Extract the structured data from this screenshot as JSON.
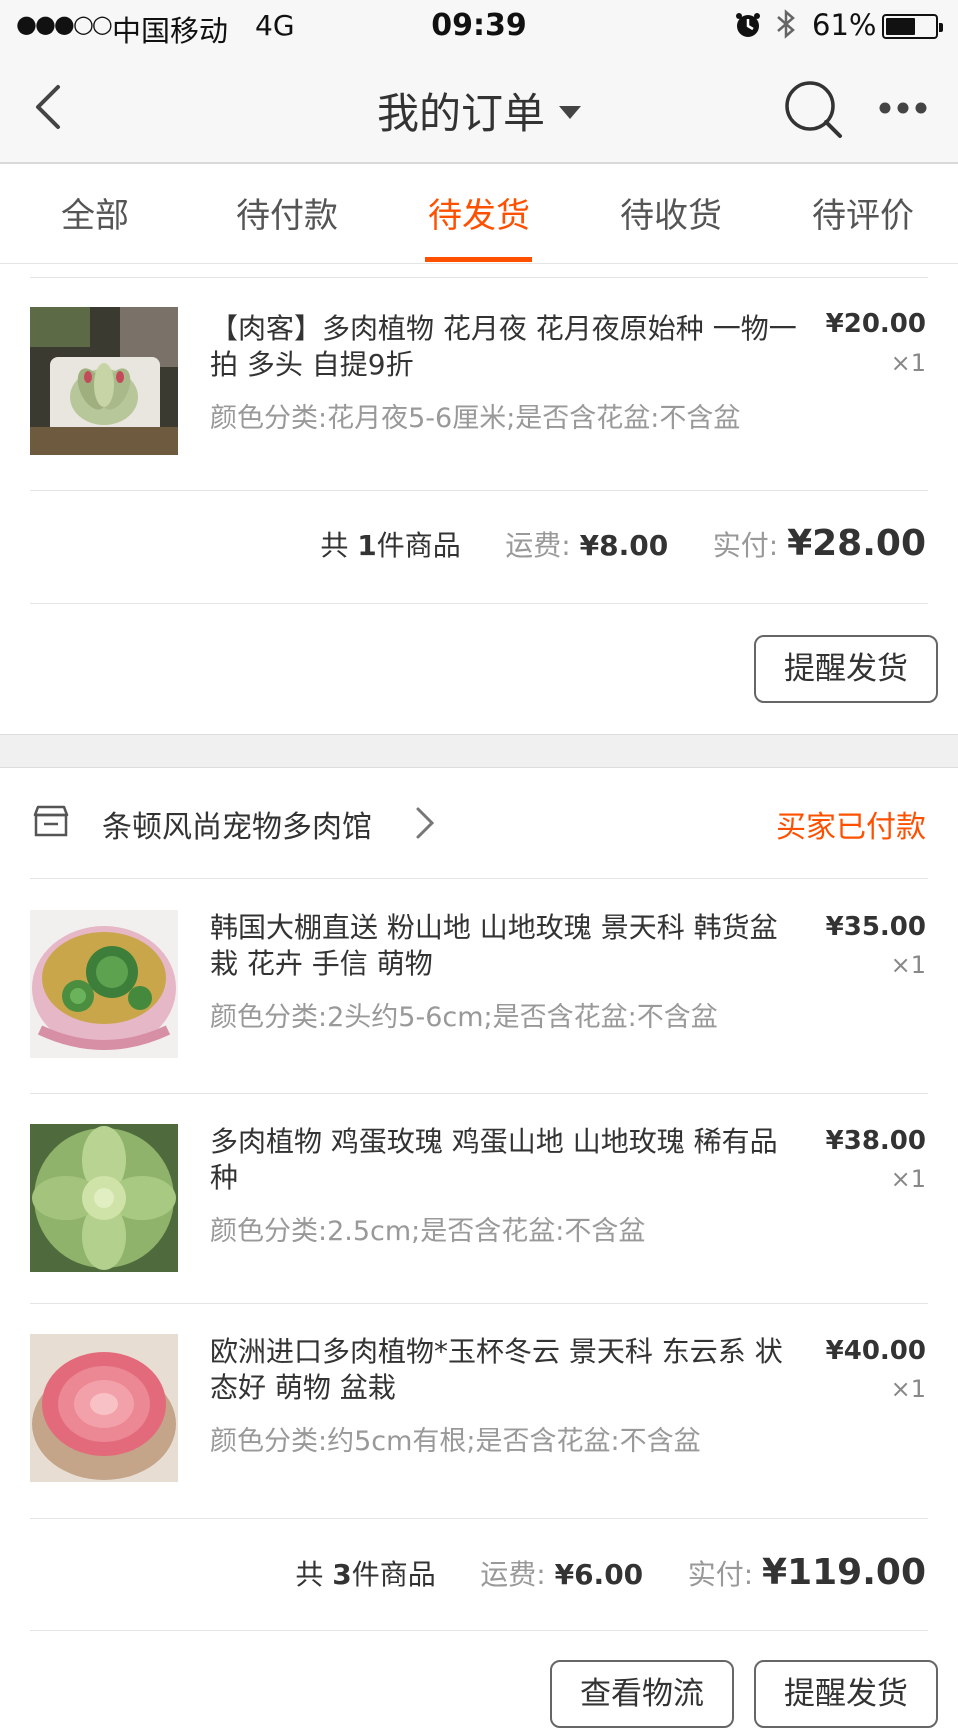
{
  "status_bar": {
    "signal": "●●●○○",
    "carrier": "中国移动",
    "network": "4G",
    "time": "09:39",
    "battery_pct": "61%",
    "battery_level": 0.61
  },
  "nav": {
    "title": "我的订单"
  },
  "tabs": [
    {
      "label": "全部"
    },
    {
      "label": "待付款"
    },
    {
      "label": "待发货"
    },
    {
      "label": "待收货"
    },
    {
      "label": "待评价"
    }
  ],
  "active_tab": 2,
  "order1": {
    "item": {
      "name": "【肉客】多肉植物 花月夜 花月夜原始种 一物一拍 多头 自提9折",
      "sku": "颜色分类:花月夜5-6厘米;是否含花盆:不含盆",
      "price": "¥20.00",
      "qty": "×1"
    },
    "summary": {
      "count_prefix": "共",
      "count": "1",
      "count_suffix": "件商品",
      "shipping_label": "运费:",
      "shipping": "¥8.00",
      "paid_label": "实付:",
      "paid": "¥28.00"
    },
    "remind_button": "提醒发货"
  },
  "order2": {
    "shop_name": "条顿风尚宠物多肉馆",
    "status": "买家已付款",
    "items": [
      {
        "name": "韩国大棚直送 粉山地 山地玫瑰 景天科 韩货盆栽 花卉 手信 萌物",
        "sku": "颜色分类:2头约5-6cm;是否含花盆:不含盆",
        "price": "¥35.00",
        "qty": "×1"
      },
      {
        "name": "多肉植物 鸡蛋玫瑰 鸡蛋山地  山地玫瑰 稀有品种",
        "sku": "颜色分类:2.5cm;是否含花盆:不含盆",
        "price": "¥38.00",
        "qty": "×1"
      },
      {
        "name": "欧洲进口多肉植物*玉杯冬云 景天科 东云系 状态好  萌物 盆栽",
        "sku": "颜色分类:约5cm有根;是否含花盆:不含盆",
        "price": "¥40.00",
        "qty": "×1"
      }
    ],
    "summary": {
      "count_prefix": "共",
      "count": "3",
      "count_suffix": "件商品",
      "shipping_label": "运费:",
      "shipping": "¥6.00",
      "paid_label": "实付:",
      "paid": "¥119.00"
    },
    "logistics_button": "查看物流",
    "remind_button": "提醒发货"
  },
  "colors": {
    "accent": "#ff5000",
    "background": "#f7f7f7"
  }
}
